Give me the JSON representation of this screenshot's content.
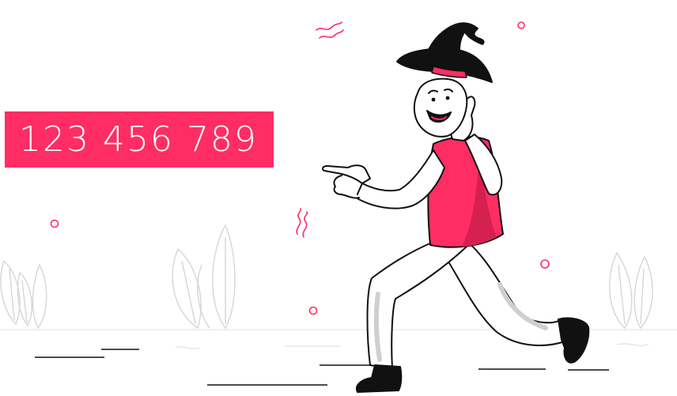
{
  "banner": {
    "number": "123 456 789"
  },
  "colors": {
    "accent": "#ff2d63",
    "ink": "#111111",
    "background": "#ffffff",
    "decor_line": "#d9d9d9"
  },
  "icons": [
    "witch-hat-icon",
    "sparkle-squiggle-icon",
    "plant-leaf-icon",
    "dot-ring-icon"
  ]
}
